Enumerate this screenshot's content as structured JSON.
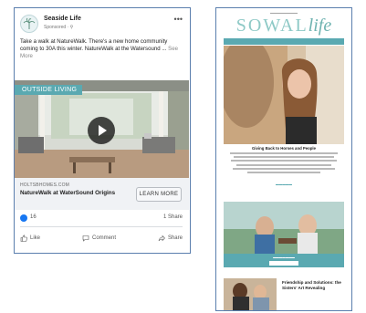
{
  "facebook_ad": {
    "page_name": "Seaside Life",
    "sponsored_label": "Sponsored · ⚲",
    "more_icon": "ellipsis-icon",
    "post_text": "Take a walk at NatureWalk. There's a new home community coming to 30A this winter. NatureWalk at the Watersound ...",
    "see_more": "See More",
    "media_tag": "OUTSIDE LIVING",
    "link_domain": "HOLTSBHOMES.COM",
    "link_headline": "NatureWalk at WaterSound Origins",
    "cta_label": "LEARN MORE",
    "reaction_count": "16",
    "shares": "1 Share",
    "actions": {
      "like": "Like",
      "comment": "Comment",
      "share": "Share"
    },
    "colors": {
      "accent": "#5aa9b1",
      "facebook_blue": "#1877f2",
      "frame": "#5b7fae"
    }
  },
  "newsletter": {
    "logo_main": "SOWAL",
    "logo_script": "life",
    "story_headline": "Giving Back to Horses and People",
    "bottom_title": "Friendship and Solutions: the Sisters' Art Revealing",
    "colors": {
      "accent": "#5aa9b1",
      "logo": "#8ec9c6"
    }
  }
}
